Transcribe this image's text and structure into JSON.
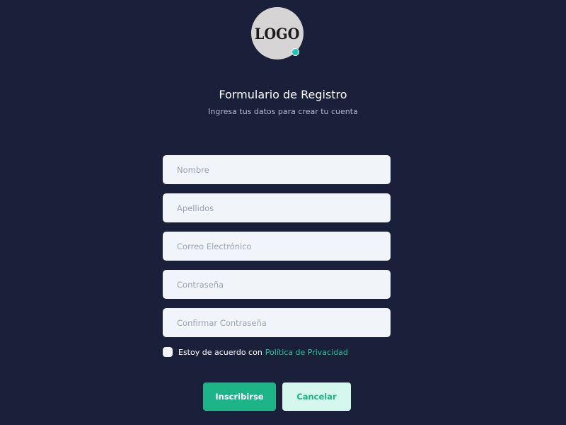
{
  "logo": {
    "text": "LOGO",
    "background_color": "#d6d4d4",
    "status_dot_color": "#20c6b8"
  },
  "header": {
    "title": "Formulario de Registro",
    "subtitle": "Ingresa tus datos para crear tu cuenta"
  },
  "form": {
    "fields": [
      {
        "placeholder": "Nombre",
        "value": ""
      },
      {
        "placeholder": "Apellidos",
        "value": ""
      },
      {
        "placeholder": "Correo Electrónico",
        "value": ""
      },
      {
        "placeholder": "Contraseña",
        "value": ""
      },
      {
        "placeholder": "Confirmar Contraseña",
        "value": ""
      }
    ],
    "agreement": {
      "checked": false,
      "text": "Estoy de acuerdo con",
      "link_text": "Política de Privacidad"
    }
  },
  "actions": {
    "submit_label": "Inscribirse",
    "cancel_label": "Cancelar"
  },
  "colors": {
    "background": "#1a1f3a",
    "accent": "#1db587",
    "accent_light": "#d5f7ee",
    "input_background": "#f1f5f9",
    "link": "#22c79b"
  }
}
